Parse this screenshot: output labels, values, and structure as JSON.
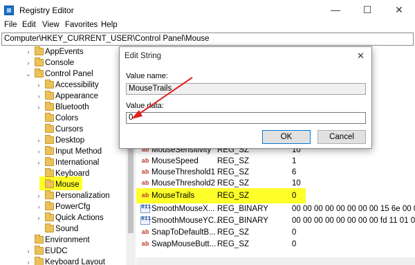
{
  "window": {
    "title": "Registry Editor",
    "minimize_glyph": "—",
    "maximize_glyph": "☐",
    "close_glyph": "✕"
  },
  "menu": [
    "File",
    "Edit",
    "View",
    "Favorites",
    "Help"
  ],
  "address": "Computer\\HKEY_CURRENT_USER\\Control Panel\\Mouse",
  "tree": {
    "items": [
      {
        "label": "AppEvents",
        "expander": "›"
      },
      {
        "label": "Console",
        "expander": "›"
      },
      {
        "label": "Control Panel",
        "expander": "⌄"
      },
      {
        "label": "Accessibility",
        "expander": "›"
      },
      {
        "label": "Appearance",
        "expander": "›"
      },
      {
        "label": "Bluetooth",
        "expander": "›"
      },
      {
        "label": "Colors",
        "expander": ""
      },
      {
        "label": "Cursors",
        "expander": ""
      },
      {
        "label": "Desktop",
        "expander": "›"
      },
      {
        "label": "Input Method",
        "expander": "›"
      },
      {
        "label": "International",
        "expander": "›"
      },
      {
        "label": "Keyboard",
        "expander": ""
      },
      {
        "label": "Mouse",
        "expander": ""
      },
      {
        "label": "Personalization",
        "expander": "›"
      },
      {
        "label": "PowerCfg",
        "expander": "›"
      },
      {
        "label": "Quick Actions",
        "expander": "›"
      },
      {
        "label": "Sound",
        "expander": ""
      },
      {
        "label": "Environment",
        "expander": ""
      },
      {
        "label": "EUDC",
        "expander": "›"
      },
      {
        "label": "Keyboard Layout",
        "expander": "›"
      }
    ]
  },
  "values": {
    "rows": [
      {
        "icon": "ab",
        "name": "MouseSensitivity",
        "type": "REG_SZ",
        "data": "10"
      },
      {
        "icon": "ab",
        "name": "MouseSpeed",
        "type": "REG_SZ",
        "data": "1"
      },
      {
        "icon": "ab",
        "name": "MouseThreshold1",
        "type": "REG_SZ",
        "data": "6"
      },
      {
        "icon": "ab",
        "name": "MouseThreshold2",
        "type": "REG_SZ",
        "data": "10"
      },
      {
        "icon": "ab",
        "name": "MouseTrails",
        "type": "REG_SZ",
        "data": "0"
      },
      {
        "icon": "011",
        "name": "SmoothMouseX...",
        "type": "REG_BINARY",
        "data": "00 00 00 00 00 00 00 00 15 6e 00 0"
      },
      {
        "icon": "011",
        "name": "SmoothMouseYC...",
        "type": "REG_BINARY",
        "data": "00 00 00 00 00 00 00 00 fd 11 01 0"
      },
      {
        "icon": "ab",
        "name": "SnapToDefaultB...",
        "type": "REG_SZ",
        "data": "0"
      },
      {
        "icon": "ab",
        "name": "SwapMouseButt...",
        "type": "REG_SZ",
        "data": "0"
      }
    ]
  },
  "dialog": {
    "title": "Edit String",
    "close_glyph": "✕",
    "value_name_label": "Value name:",
    "value_name": "MouseTrails",
    "value_data_label": "Value data:",
    "value_data": "0",
    "ok_label": "OK",
    "cancel_label": "Cancel"
  },
  "colors": {
    "highlight": "#ffff2a",
    "annotation_arrow": "#e02020"
  }
}
